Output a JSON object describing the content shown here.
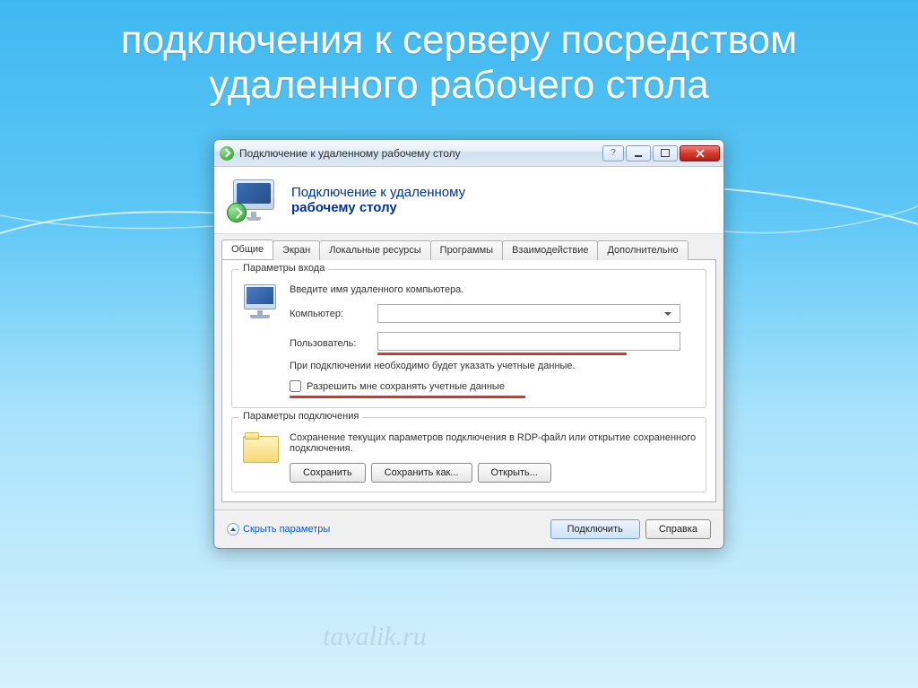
{
  "slide": {
    "title": "подключения к серверу посредством удаленного рабочего стола"
  },
  "window": {
    "title": "Подключение к удаленному рабочему столу",
    "header_line1": "Подключение к удаленному",
    "header_line2": "рабочему столу"
  },
  "tabs": [
    {
      "label": "Общие",
      "active": true
    },
    {
      "label": "Экран",
      "active": false
    },
    {
      "label": "Локальные ресурсы",
      "active": false
    },
    {
      "label": "Программы",
      "active": false
    },
    {
      "label": "Взаимодействие",
      "active": false
    },
    {
      "label": "Дополнительно",
      "active": false
    }
  ],
  "login_group": {
    "legend": "Параметры входа",
    "instruction": "Введите имя удаленного компьютера.",
    "computer_label": "Компьютер:",
    "computer_value": "",
    "user_label": "Пользователь:",
    "user_value": "",
    "hint": "При подключении необходимо будет указать учетные данные.",
    "save_creds_label": "Разрешить мне сохранять учетные данные",
    "save_creds_checked": false
  },
  "conn_group": {
    "legend": "Параметры подключения",
    "desc": "Сохранение текущих параметров подключения в RDP-файл или открытие сохраненного подключения.",
    "save_btn": "Сохранить",
    "saveas_btn": "Сохранить как...",
    "open_btn": "Открыть..."
  },
  "footer": {
    "hide_params": "Скрыть параметры",
    "connect_btn": "Подключить",
    "help_btn": "Справка"
  },
  "watermark": "tavalik.ru"
}
